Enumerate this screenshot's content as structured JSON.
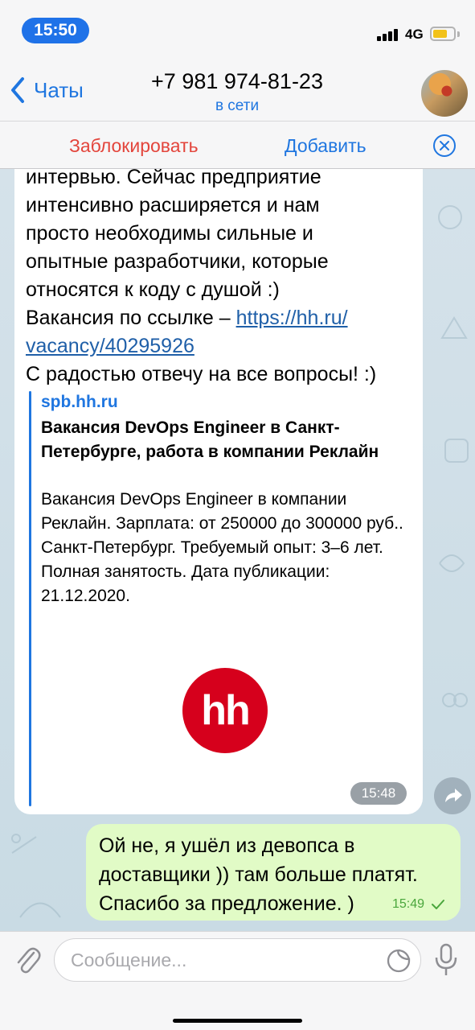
{
  "status_bar": {
    "time": "15:50",
    "network": "4G"
  },
  "header": {
    "back_label": "Чаты",
    "title": "+7 981 974-81-23",
    "subtitle": "в сети"
  },
  "action_bar": {
    "block_label": "Заблокировать",
    "add_label": "Добавить"
  },
  "incoming_message": {
    "lines": [
      "интервью. Сейчас предприятие",
      "интенсивно расширяется и нам",
      "просто необходимы сильные и",
      "опытные разработчики, которые",
      "относятся к коду с душой :)"
    ],
    "vacancy_prefix": "Вакансия по ссылке – ",
    "link_part1": "https://hh.ru/",
    "link_part2": "vacancy/40295926",
    "closing_line": "С радостью отвечу на все вопросы! :)",
    "preview": {
      "site": "spb.hh.ru",
      "title": "Вакансия DevOps Engineer в Санкт-Петербурге, работа в компании Реклайн",
      "description": "Вакансия DevOps Engineer в компании Реклайн. Зарплата: от 250000 до 300000 руб.. Санкт-Петербург. Требуемый опыт: 3–6 лет. Полная занятость. Дата публикации: 21.12.2020.",
      "logo_text": "hh"
    },
    "time": "15:48"
  },
  "outgoing_message": {
    "text": "Ой не, я ушёл из девопса в доставщики )) там больше платят. Спасибо за предложение. )",
    "time": "15:49"
  },
  "input": {
    "placeholder": "Сообщение..."
  },
  "colors": {
    "accent": "#1f76e0",
    "danger": "#e3453c",
    "outgoing_bubble": "#e1fbc6",
    "hh_brand": "#d6001c"
  }
}
